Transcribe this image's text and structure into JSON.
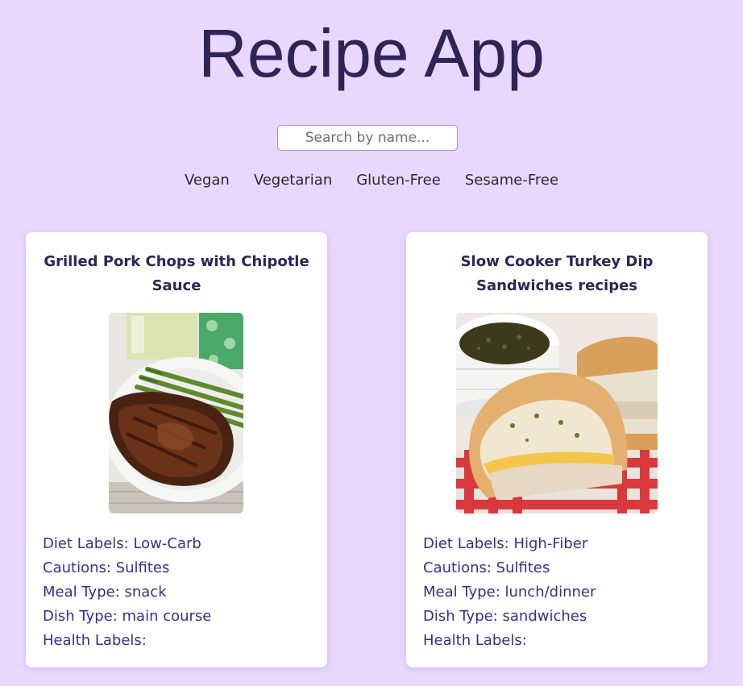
{
  "app": {
    "title": "Recipe App"
  },
  "search": {
    "placeholder": "Search by name..."
  },
  "filters": [
    "Vegan",
    "Vegetarian",
    "Gluten-Free",
    "Sesame-Free"
  ],
  "recipes": [
    {
      "title": "Grilled Pork Chops with Chipotle Sauce",
      "image_icon": "pork-chop-photo",
      "details": [
        "Diet Labels: Low-Carb",
        "Cautions: Sulfites",
        "Meal Type: snack",
        "Dish Type: main course",
        "Health Labels:"
      ]
    },
    {
      "title": "Slow Cooker Turkey Dip Sandwiches recipes",
      "image_icon": "turkey-dip-sandwich-photo",
      "details": [
        "Diet Labels: High-Fiber",
        "Cautions: Sulfites",
        "Meal Type: lunch/dinner",
        "Dish Type: sandwiches",
        "Health Labels:"
      ]
    }
  ],
  "colors": {
    "background": "#e8d8ff",
    "title": "#2e2457",
    "detail_text": "#3d2a8f",
    "card": "#ffffff"
  }
}
